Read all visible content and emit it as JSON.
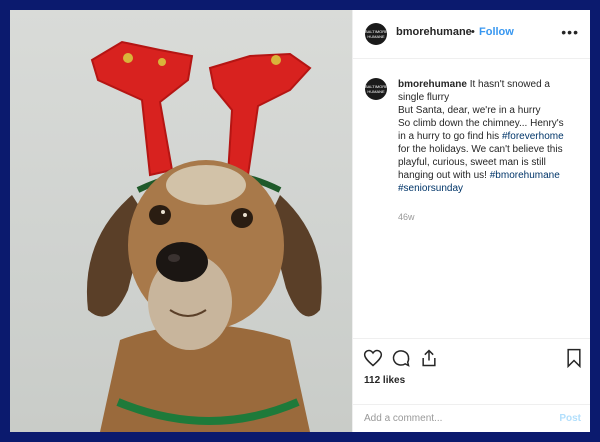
{
  "post": {
    "username": "bmorehumane",
    "follow_separator": "•",
    "follow_label": "Follow",
    "more_icon": "more-options-icon",
    "avatar_text": "BALTIMORE HUMANE"
  },
  "caption": {
    "username": "bmorehumane",
    "line1": "It hasn't snowed a",
    "line2": "single flurry",
    "line3": "But Santa, dear, we're in a hurry",
    "line4": "So climb down the chimney... Henry's",
    "line5": "in a hurry to go find his",
    "hashtag1": "#foreverhome",
    "line6": "for the holidays. We can't believe this",
    "line7": "playful, curious, sweet man is still",
    "line8": "hanging out with us!",
    "hashtag2": "#bmorehumane",
    "hashtag3": "#seniorsunday",
    "age": "46w"
  },
  "actions": {
    "icons": [
      "heart-icon",
      "comment-icon",
      "share-icon",
      "bookmark-icon"
    ],
    "likes": "112 likes"
  },
  "comment_box": {
    "placeholder": "Add a comment...",
    "post_label": "Post"
  },
  "colors": {
    "border": "#0b1a6e",
    "link_blue": "#3897f0",
    "hashtag": "#003569",
    "post_disabled": "#b2dffc"
  }
}
